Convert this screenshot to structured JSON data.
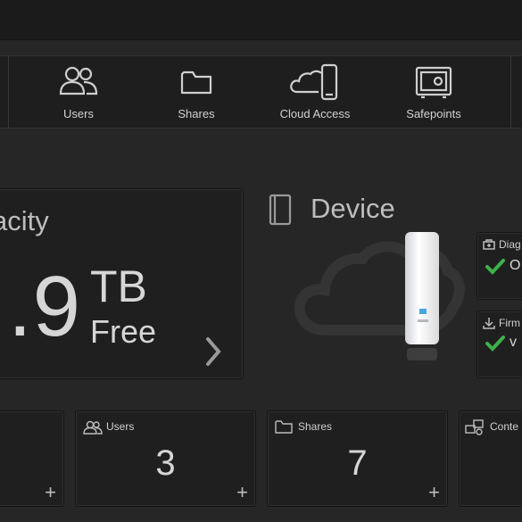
{
  "nav": {
    "items": [
      {
        "label": "Users",
        "icon": "users-icon"
      },
      {
        "label": "Shares",
        "icon": "folder-icon"
      },
      {
        "label": "Cloud Access",
        "icon": "cloud-access-icon"
      },
      {
        "label": "Safepoints",
        "icon": "safe-icon"
      }
    ]
  },
  "capacity": {
    "title": "acity",
    "value": ".9",
    "unit": "TB",
    "free_label": "Free"
  },
  "device": {
    "title": "Device",
    "diagnostics": {
      "title": "Diag",
      "value": "O"
    },
    "firmware": {
      "title": "Firm",
      "value": "v"
    }
  },
  "tiles": [
    {
      "label": "Users",
      "value": "3",
      "icon": "users-icon"
    },
    {
      "label": "Shares",
      "value": "7",
      "icon": "folder-icon"
    },
    {
      "label": "Conte",
      "icon": "content-icon"
    }
  ],
  "colors": {
    "accent_check": "#3db14a",
    "background": "#262626"
  }
}
